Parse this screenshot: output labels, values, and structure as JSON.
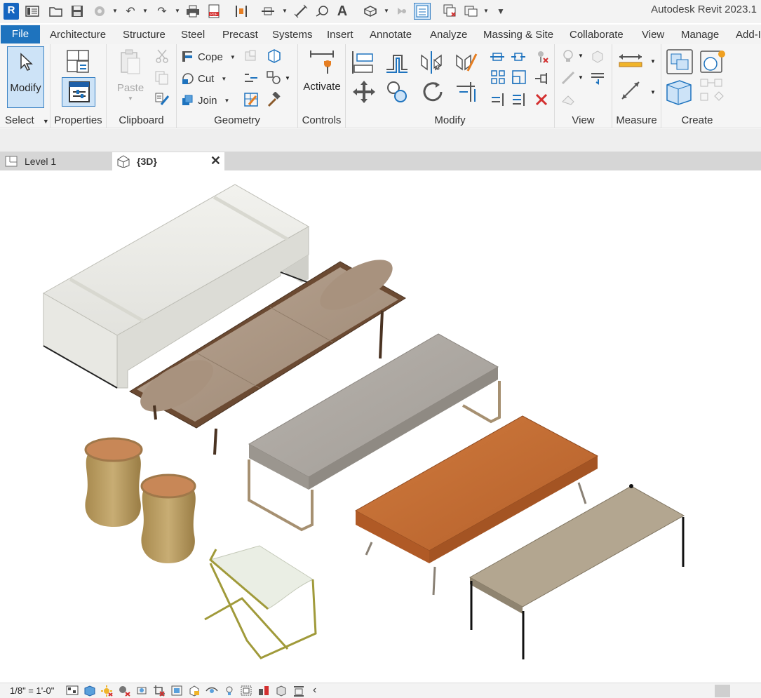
{
  "app": {
    "title": "Autodesk Revit 2023.1",
    "logo": "R"
  },
  "ribbon_tabs": [
    "File",
    "Architecture",
    "Structure",
    "Steel",
    "Precast",
    "Systems",
    "Insert",
    "Annotate",
    "Analyze",
    "Massing & Site",
    "Collaborate",
    "View",
    "Manage",
    "Add-I"
  ],
  "panels": {
    "select": {
      "modify_label": "Modify",
      "title": "Select"
    },
    "properties": {
      "title": "Properties"
    },
    "clipboard": {
      "paste_label": "Paste",
      "title": "Clipboard"
    },
    "geometry": {
      "cope_label": "Cope",
      "cut_label": "Cut",
      "join_label": "Join",
      "title": "Geometry"
    },
    "controls": {
      "activate_label": "Activate",
      "title": "Controls"
    },
    "modify": {
      "title": "Modify"
    },
    "view": {
      "title": "View"
    },
    "measure": {
      "title": "Measure"
    },
    "create": {
      "title": "Create"
    }
  },
  "view_tabs": [
    {
      "label": "Level 1"
    },
    {
      "label": "{3D}"
    }
  ],
  "status": {
    "scale": "1/8\" = 1'-0\""
  },
  "colors": {
    "accent": "#1e73be",
    "ribbon_bg": "#f5f5f5",
    "tab_strip": "#d6d6d6"
  }
}
